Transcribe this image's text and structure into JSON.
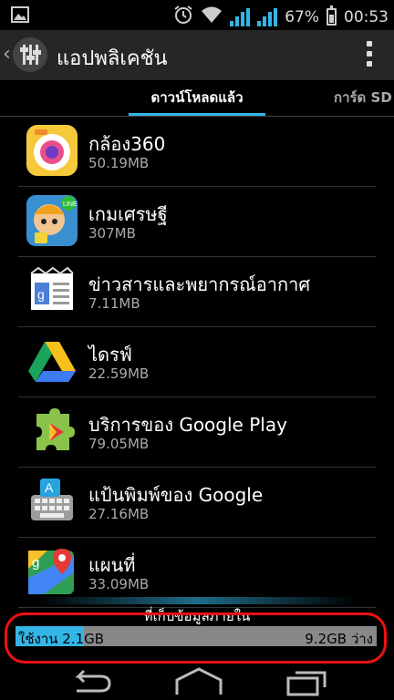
{
  "status_bar": {
    "battery": "67%",
    "time": "00:53"
  },
  "header": {
    "title": "แอปพลิเคชัน"
  },
  "tabs": [
    {
      "label": "ดาวน์โหลดแล้ว",
      "selected": true
    },
    {
      "label": "การ์ด SD",
      "selected": false
    }
  ],
  "apps": [
    {
      "name": "กล้อง360",
      "size": "50.19MB",
      "icon": "camera360-icon"
    },
    {
      "name": "เกมเศรษฐี",
      "size": "307MB",
      "icon": "line-game-icon"
    },
    {
      "name": "ข่าวสารและพยากรณ์อากาศ",
      "size": "7.11MB",
      "icon": "news-weather-icon"
    },
    {
      "name": "ไดรฟ์",
      "size": "22.59MB",
      "icon": "google-drive-icon"
    },
    {
      "name": "บริการของ Google Play",
      "size": "79.05MB",
      "icon": "google-play-services-icon"
    },
    {
      "name": "แป้นพิมพ์ของ Google",
      "size": "27.16MB",
      "icon": "google-keyboard-icon"
    },
    {
      "name": "แผนที่",
      "size": "33.09MB",
      "icon": "google-maps-icon"
    }
  ],
  "storage": {
    "label": "ที่เก็บข้อมูลภายใน",
    "used_label": "ใช้งาน 2.1GB",
    "free_label": "9.2GB ว่าง",
    "used_fraction": 0.19
  },
  "colors": {
    "accent": "#33b5e5",
    "annotation": "#e11111"
  }
}
